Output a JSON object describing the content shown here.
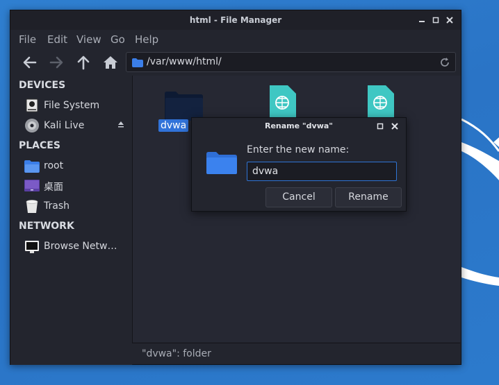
{
  "window": {
    "title": "html - File Manager"
  },
  "menu": [
    "File",
    "Edit",
    "View",
    "Go",
    "Help"
  ],
  "address": {
    "path": "/var/www/html/"
  },
  "sidebar": {
    "devices_heading": "DEVICES",
    "places_heading": "PLACES",
    "network_heading": "NETWORK",
    "devices": [
      {
        "label": "File System",
        "icon": "drive-icon"
      },
      {
        "label": "Kali Live",
        "icon": "disc-icon"
      }
    ],
    "places": [
      {
        "label": "root",
        "icon": "home-folder-icon"
      },
      {
        "label": "桌面",
        "icon": "desktop-folder-icon"
      },
      {
        "label": "Trash",
        "icon": "trash-icon"
      }
    ],
    "network": [
      {
        "label": "Browse Netw…",
        "icon": "network-icon"
      }
    ]
  },
  "files": [
    {
      "label": "dvwa",
      "type": "folder",
      "selected": true
    },
    {
      "label": "",
      "type": "html"
    },
    {
      "label": "",
      "type": "html"
    }
  ],
  "status": {
    "text": "\"dvwa\": folder"
  },
  "dialog": {
    "title": "Rename \"dvwa\"",
    "prompt": "Enter the new name:",
    "value": "dvwa",
    "cancel": "Cancel",
    "rename": "Rename"
  },
  "colors": {
    "accent": "#3173d9",
    "folder": "#3b7ee8",
    "web_file": "#3fc7c3",
    "desktop_bg": "#2c78c9"
  }
}
